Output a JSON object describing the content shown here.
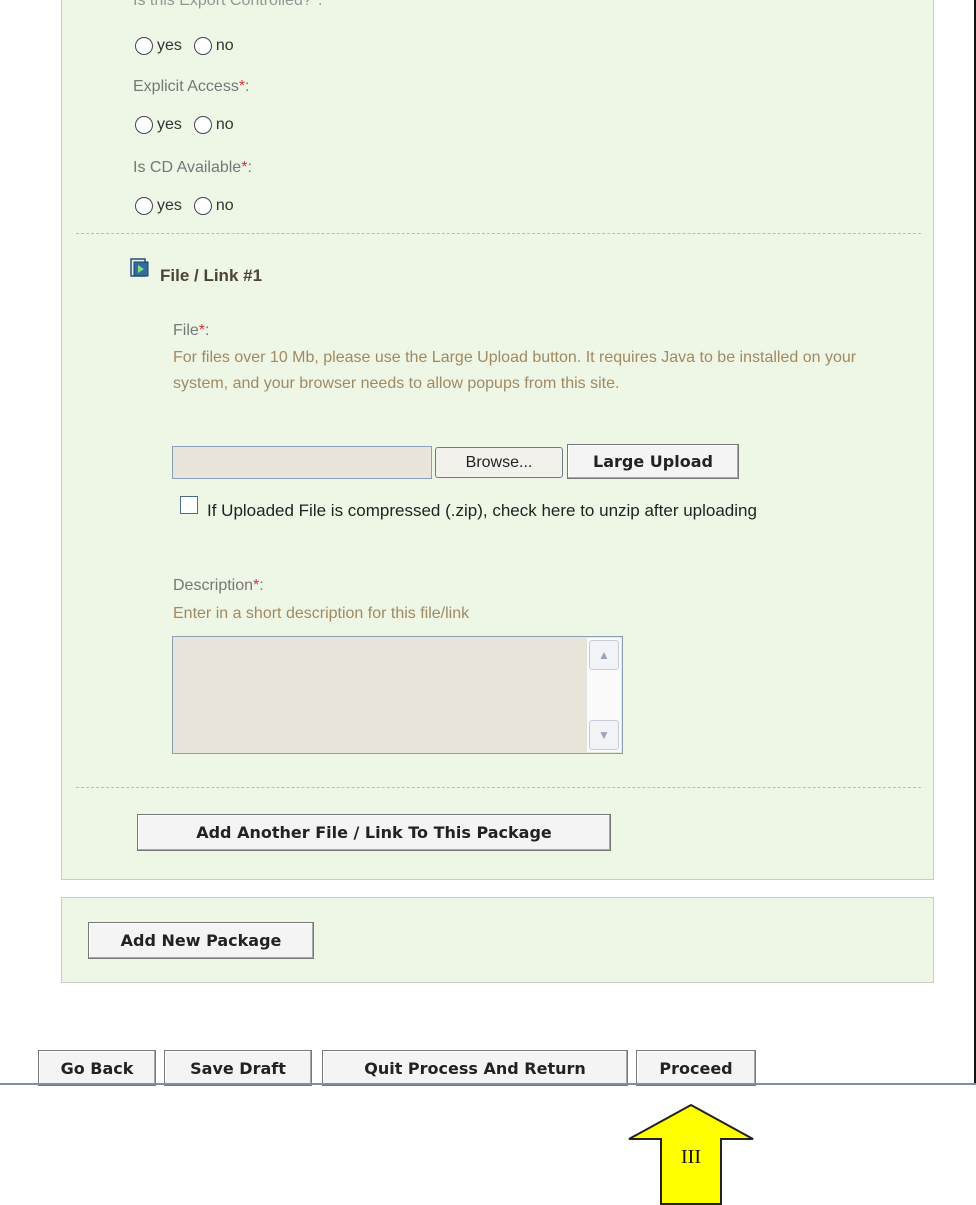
{
  "questions": [
    {
      "label": "Is this Export Controlled?",
      "required_mark": "*",
      "options": [
        "yes",
        "no"
      ]
    },
    {
      "label": "Explicit Access",
      "required_mark": "*",
      "options": [
        "yes",
        "no"
      ]
    },
    {
      "label": "Is CD Available",
      "required_mark": "*",
      "options": [
        "yes",
        "no"
      ]
    }
  ],
  "file_section": {
    "title": "File / Link #1",
    "file_label": "File",
    "required_mark": "*",
    "file_help": "For files over 10 Mb, please use the Large Upload button. It requires Java to be installed on your system, and your browser needs to allow popups from this site.",
    "file_value": "",
    "browse_label": "Browse...",
    "large_upload_label": "Large Upload",
    "unzip_label": "If Uploaded File is compressed (.zip), check here to unzip after uploading",
    "unzip_checked": false,
    "description_label": "Description",
    "description_help": "Enter in a short description for this file/link",
    "description_value": ""
  },
  "buttons": {
    "add_another": "Add Another File / Link To This Package",
    "add_package": "Add New Package",
    "go_back": "Go Back",
    "save_draft": "Save Draft",
    "quit": "Quit Process And Return",
    "proceed": "Proceed"
  },
  "annotation": {
    "label": "III",
    "color": "#ffff00"
  }
}
